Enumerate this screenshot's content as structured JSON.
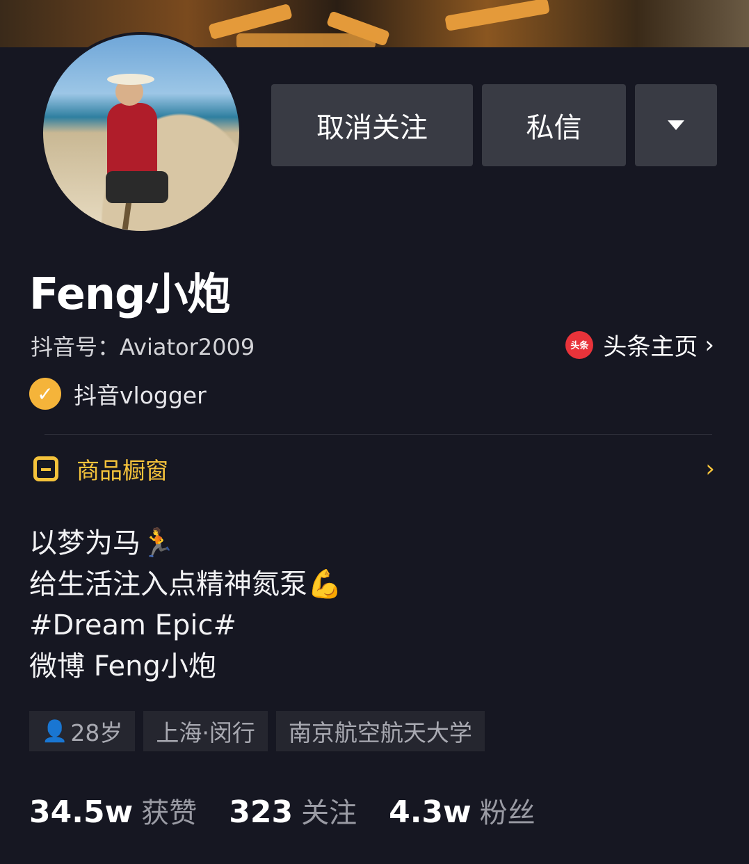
{
  "profile": {
    "name": "Feng小炮",
    "douyin_id": "抖音号：Aviator2009",
    "verification": "抖音vlogger",
    "toutiao": {
      "logo_text": "头条",
      "label": "头条主页"
    }
  },
  "actions": {
    "unfollow": "取消关注",
    "message": "私信"
  },
  "shop": {
    "label": "商品橱窗"
  },
  "bio": [
    "以梦为马🏃",
    "给生活注入点精神氮泵💪",
    "#Dream Epic#",
    "微博 Feng小炮"
  ],
  "tags": {
    "age": "28岁",
    "location": "上海·闵行",
    "school": "南京航空航天大学"
  },
  "stats": [
    {
      "value": "34.5w",
      "label": "获赞"
    },
    {
      "value": "323",
      "label": "关注"
    },
    {
      "value": "4.3w",
      "label": "粉丝"
    }
  ],
  "colors": {
    "background": "#161722",
    "accent_yellow": "#f5c33b",
    "button": "#393b44",
    "verify": "#f5b43a"
  }
}
